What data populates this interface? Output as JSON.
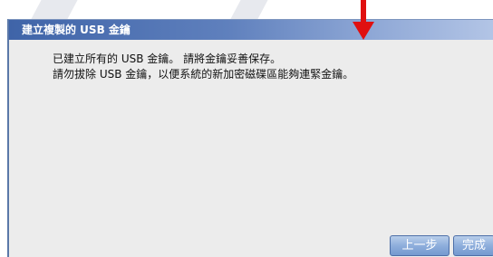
{
  "dialog": {
    "title": "建立複製的 USB 金鑰",
    "message_lines": [
      "已建立所有的 USB 金鑰。 請將金鑰妥善保存。",
      "請勿拔除 USB 金鑰，以便系統的新加密磁碟區能夠連緊金鑰。"
    ]
  },
  "buttons": {
    "back_label": "上一步",
    "finish_label": "完成"
  },
  "annotation": {
    "arrow_color": "#e01010",
    "icon": "down-arrow-icon"
  },
  "colors": {
    "title_bar": "#3f64a8",
    "dialog_bg": "#ececec",
    "button": "#8eaedc"
  }
}
